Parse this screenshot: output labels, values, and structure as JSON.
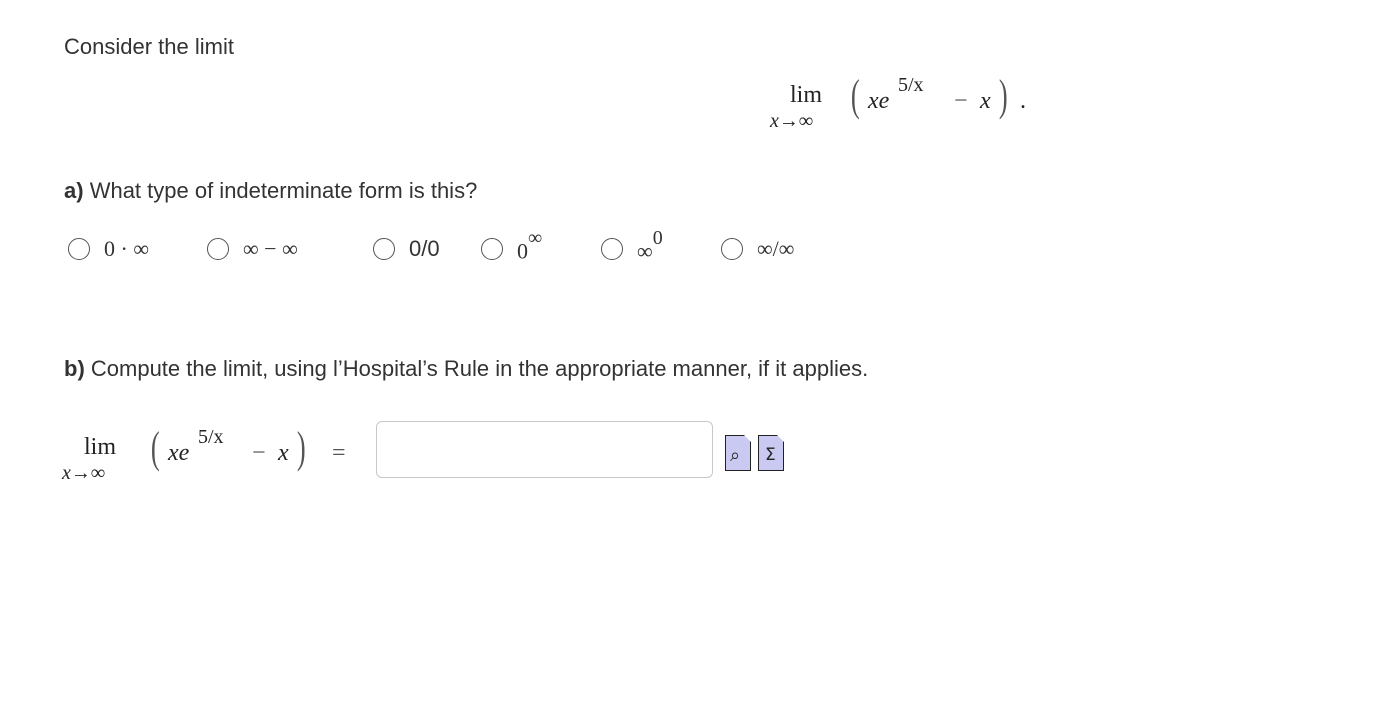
{
  "intro": "Consider the limit",
  "display_limit": {
    "lim": "lim",
    "sub": "x→∞",
    "left_paren": "(",
    "x1": "xe",
    "exp": "5/x",
    "minus": "−",
    "x2": "x",
    "right_paren": ")",
    "end": "."
  },
  "part_a": {
    "label": "a)",
    "question": "What type of indeterminate form is this?",
    "options": [
      {
        "base": "0 · ∞",
        "sup": ""
      },
      {
        "base": "∞ − ∞",
        "sup": ""
      },
      {
        "base": "0/0",
        "sup": ""
      },
      {
        "base": "0",
        "sup": "∞"
      },
      {
        "base": "∞",
        "sup": "0"
      },
      {
        "base": "∞/∞",
        "sup": ""
      }
    ]
  },
  "part_b": {
    "label": "b)",
    "question": "Compute the limit, using l’Hospital’s Rule in the appropriate manner, if it applies.",
    "lim": "lim",
    "sub": "x→∞",
    "left_paren": "(",
    "x1": "xe",
    "exp": "5/x",
    "minus": "−",
    "x2": "x",
    "right_paren": ")",
    "equals": "=",
    "answer_value": "",
    "preview_icon_glyph": "⌕",
    "equation_icon_glyph": "Σ"
  },
  "icons": {
    "preview": "preview-answer-icon",
    "equation": "equation-editor-icon"
  },
  "colors": {
    "text": "#333333",
    "icon_fill": "#c9c9f2",
    "input_border": "#c8c8c8"
  }
}
